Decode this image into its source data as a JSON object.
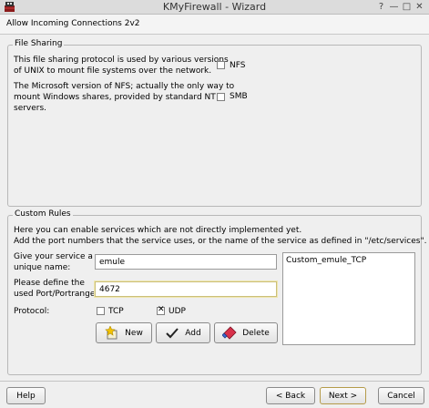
{
  "window": {
    "title": "KMyFirewall - Wizard",
    "controls": {
      "help": "?",
      "minimize": "—",
      "maximize": "□",
      "close": "✕"
    }
  },
  "header": {
    "title": "Allow Incoming Connections 2v2"
  },
  "file_sharing": {
    "legend": "File Sharing",
    "nfs_desc_1": "This file sharing protocol is used by various versions",
    "nfs_desc_2": "of UNIX to mount file systems over the network.",
    "nfs_label": "NFS",
    "nfs_checked": false,
    "smb_desc_1": "The Microsoft version of NFS; actually the only way to",
    "smb_desc_2": "mount Windows shares, provided by standard NT",
    "smb_desc_3": "servers.",
    "smb_label": "SMB",
    "smb_checked": false
  },
  "custom_rules": {
    "legend": "Custom Rules",
    "intro_1": "Here you can enable services which are not directly implemented yet.",
    "intro_2": "Add the port numbers that the service uses, or the name of the service as defined in \"/etc/services\".",
    "name_label_1": "Give your service a",
    "name_label_2": "unique name:",
    "name_value": "emule",
    "port_label_1": "Please define the",
    "port_label_2": "used Port/Portrange:",
    "port_value": "4672",
    "protocol_label": "Protocol:",
    "tcp_label": "TCP",
    "tcp_checked": false,
    "udp_label": "UDP",
    "udp_checked": true,
    "new_button": "New",
    "add_button": "Add",
    "delete_button": "Delete",
    "services_list": [
      "Custom_emule_TCP"
    ]
  },
  "footer": {
    "help_button": "Help",
    "back_button": "< Back",
    "next_button": "Next >",
    "cancel_button": "Cancel"
  },
  "icons": {
    "app": "firewall-app-icon",
    "new": "new-star-icon",
    "add": "checkmark-icon",
    "delete": "eraser-icon"
  }
}
